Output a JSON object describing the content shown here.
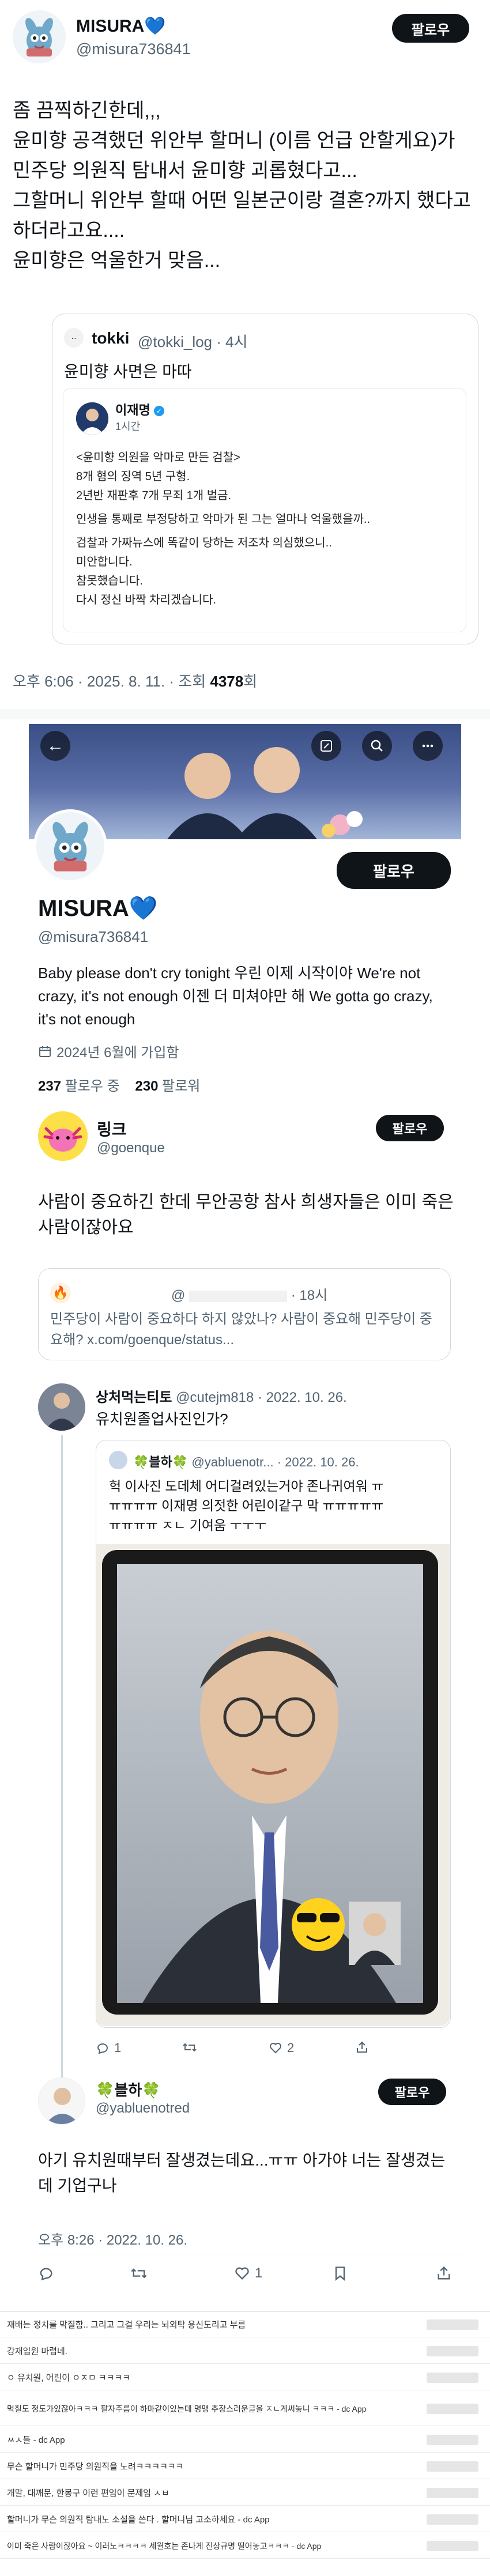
{
  "post": {
    "author_name": "MISURA",
    "author_heart": "💙",
    "author_handle": "@misura736841",
    "follow_label": "팔로우",
    "text_lines": [
      "좀 끔찍하긴한데,,,",
      "윤미향 공격했던 위안부 할머니 (이름 언급 안할게요)가",
      "민주당 의원직 탐내서 윤미향 괴롭혔다고...",
      "그할머니 위안부 할때 어떤 일본군이랑 결혼?까지 했다고",
      "하더라고요....",
      "윤미향은 억울한거 맞음..."
    ],
    "quote": {
      "name": "tokki",
      "handle": "@tokki_log",
      "time": "· 4시",
      "text": "윤미향 사면은 마따",
      "inner": {
        "name": "이재명",
        "time": "1시간",
        "lines": [
          "<윤미향 의원을 악마로 만든 검찰>",
          "8개 혐의 징역 5년 구형.",
          "2년반 재판후 7개 무죄 1개 벌금.",
          "인생을 통째로 부정당하고 악마가 된 그는 얼마나 억울했을까..",
          "검찰과 가짜뉴스에 똑같이 당하는 저조차 의심했으니..",
          "미안합니다.",
          "참못했습니다.",
          "다시 정신 바짝 차리겠습니다."
        ]
      }
    },
    "meta": "오후 6:06 · 2025. 8. 11. · 조회",
    "views": "4378",
    "views_suffix": "회"
  },
  "profile": {
    "name": "MISURA",
    "heart": "💙",
    "handle": "@misura736841",
    "follow_label": "팔로우",
    "bio": "Baby please don't cry tonight 우린 이제 시작이야 We're not crazy, it's not enough 이젠 더 미쳐야만 해 We gotta go crazy, it's not enough",
    "joined": "2024년 6월에 가입함",
    "following_count": "237",
    "following_label": "팔로우 중",
    "followers_count": "230",
    "followers_label": "팔로워"
  },
  "reply": {
    "name": "링크",
    "handle": "@goenque",
    "follow_label": "팔로우",
    "text": "사람이 중요하긴 한데 무안공항 참사 희생자들은 이미 죽은 사람이잖아요",
    "quote": {
      "handle": "@",
      "time": "· 18시",
      "text": "민주당이 사람이 중요하다 하지 않았나? 사람이 중요해 민주당이 중요해? x.com/goenque/status..."
    }
  },
  "thread": {
    "name": "상처먹는티토",
    "handle": "@cutejm818",
    "date": "· 2022. 10. 26.",
    "text": "유치원졸업사진인가?",
    "quote": {
      "name": "🍀블하🍀",
      "handle": "@yabluenotr...",
      "date": "· 2022. 10. 26.",
      "lines": [
        "헉 이사진 도데체 어디걸려있는거야 존나귀여워 ㅠ",
        "ㅠㅠㅠㅠ 이재명 의젓한 어린이같구 막 ㅠㅠㅠㅠㅠ",
        "ㅠㅠㅠㅠ ㅈㄴ 기여움 ㅜㅜㅜ"
      ]
    },
    "actions": {
      "reply": "1",
      "retweet": "",
      "like": "2"
    }
  },
  "reply2": {
    "name": "🍀블하🍀",
    "handle": "@yabluenotred",
    "follow_label": "팔로우",
    "text": "아기 유치원때부터 잘생겼는데요...ㅠㅠ 아가야 너는 잘생겼는데 기업구나",
    "meta": "오후 8:26 · 2022. 10. 26.",
    "like_count": "1"
  },
  "comments": [
    "재배는 정치를 막질함.. 그리고 그걸 우리는 뇌외탁 용신도리고 부름",
    "강재입원 마렵네.",
    "ㅇ 유치원, 어린이 ㅇㅈㅁ ㅋㅋㅋㅋ",
    "먹칠도 정도가있잖아ㅋㅋㅋ 팔자주름이 하마같이있는데 명맹 추장스러운글을 ㅈㄴ게써놓니 ㅋㅋㅋ - dc App",
    "ㅆㅅ들 - dc App",
    "무슨 할머니가 민주당 의원직을 노려ㅋㅋㅋㅋㅋㅋ",
    "개말, 대깨문, 한몽구 이런 편임이 문제임 ㅅㅂ",
    "할머니가 무슨 의원직 탐내노 소설을 쓴다 . 할머니님 고소하세요 - dc App",
    "이미 죽은 사람이잖아요 ~ 이러노ㅋㅋㅋㅋ 세월호는 존나게 진상규명 떨어놓고ㅋㅋㅋ - dc App"
  ],
  "colors": {
    "text": "#0f1419",
    "muted": "#536471",
    "border": "#cfd9de",
    "button": "#0f1419",
    "verified": "#1d9bf0",
    "like_red": "#f91880"
  }
}
